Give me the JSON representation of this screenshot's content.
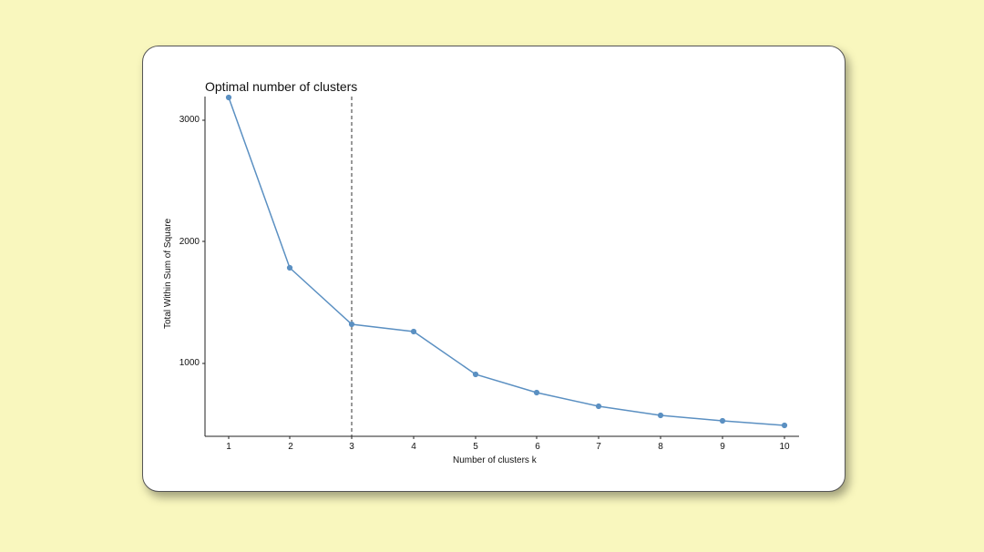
{
  "chart_data": {
    "type": "line",
    "title": "Optimal number of clusters",
    "xlabel": "Number of clusters k",
    "ylabel": "Total Within Sum of Square",
    "x": [
      1,
      2,
      3,
      4,
      5,
      6,
      7,
      8,
      9,
      10
    ],
    "values": [
      3190,
      1790,
      1320,
      1260,
      910,
      760,
      650,
      570,
      530,
      490
    ],
    "xlim": [
      1,
      10
    ],
    "ylim": [
      400,
      3300
    ],
    "y_ticks": [
      1000,
      2000,
      3000
    ],
    "x_ticks": [
      1,
      2,
      3,
      4,
      5,
      6,
      7,
      8,
      9,
      10
    ],
    "vline_x": 3,
    "line_color": "#5b90c2",
    "point_fill": "#5b90c2"
  }
}
